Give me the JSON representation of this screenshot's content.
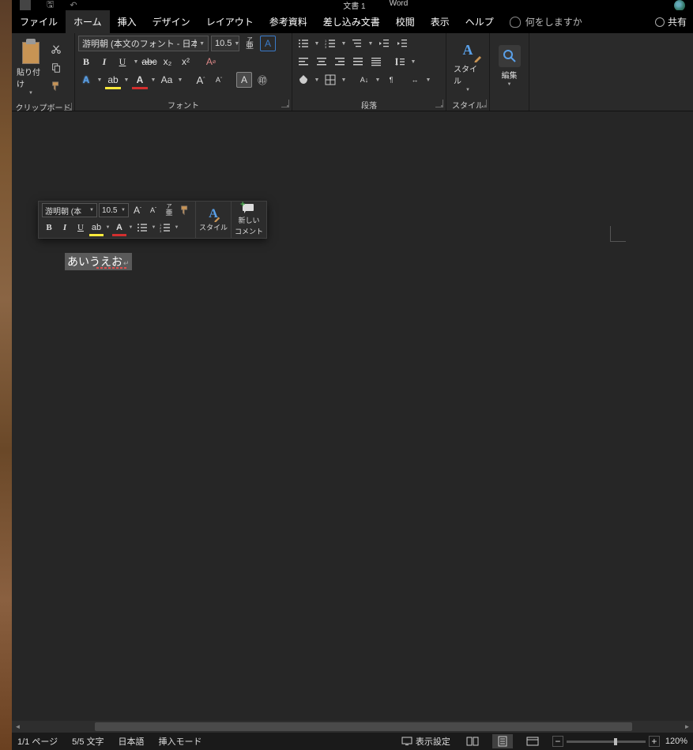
{
  "titlebar": {
    "center_left": "文書 1",
    "center_right": "Word"
  },
  "menu": {
    "file": "ファイル",
    "home": "ホーム",
    "insert": "挿入",
    "design": "デザイン",
    "layout": "レイアウト",
    "references": "参考資料",
    "mailings": "差し込み文書",
    "review": "校閲",
    "view": "表示",
    "help": "ヘルプ",
    "tellme": "何をしますか",
    "share": "共有"
  },
  "ribbon": {
    "clipboard_group": "クリップボード",
    "paste": "貼り付け",
    "font_group": "フォント",
    "font_name": "游明朝 (本文のフォント - 日本語",
    "font_size": "10.5",
    "paragraph_group": "段落",
    "style_group": "スタイル",
    "styles": "スタイル",
    "edit_group": "編集",
    "edit": "編集"
  },
  "mini": {
    "font_name": "游明朝 (本",
    "font_size": "10.5",
    "styles": "スタイル",
    "new_comment_l1": "新しい",
    "new_comment_l2": "コメント",
    "ruby_top": "ア",
    "ruby_bottom": "亜"
  },
  "document": {
    "selected_text": "あいうえお"
  },
  "status": {
    "page": "1/1 ページ",
    "words": "5/5 文字",
    "language": "日本語",
    "mode": "挿入モード",
    "view_settings": "表示設定",
    "zoom": "120%"
  },
  "glyphs": {
    "bold": "B",
    "italic": "I",
    "underline": "U",
    "strike": "abc",
    "sub": "x₂",
    "sup": "x²",
    "Aa": "Aa",
    "A_big": "A",
    "A_small": "A",
    "clear": "Aᵩ",
    "char_border": "A",
    "char_shade": "A",
    "circled": "㊞",
    "grow": "A",
    "shrink": "A",
    "align_dist": "≣"
  }
}
